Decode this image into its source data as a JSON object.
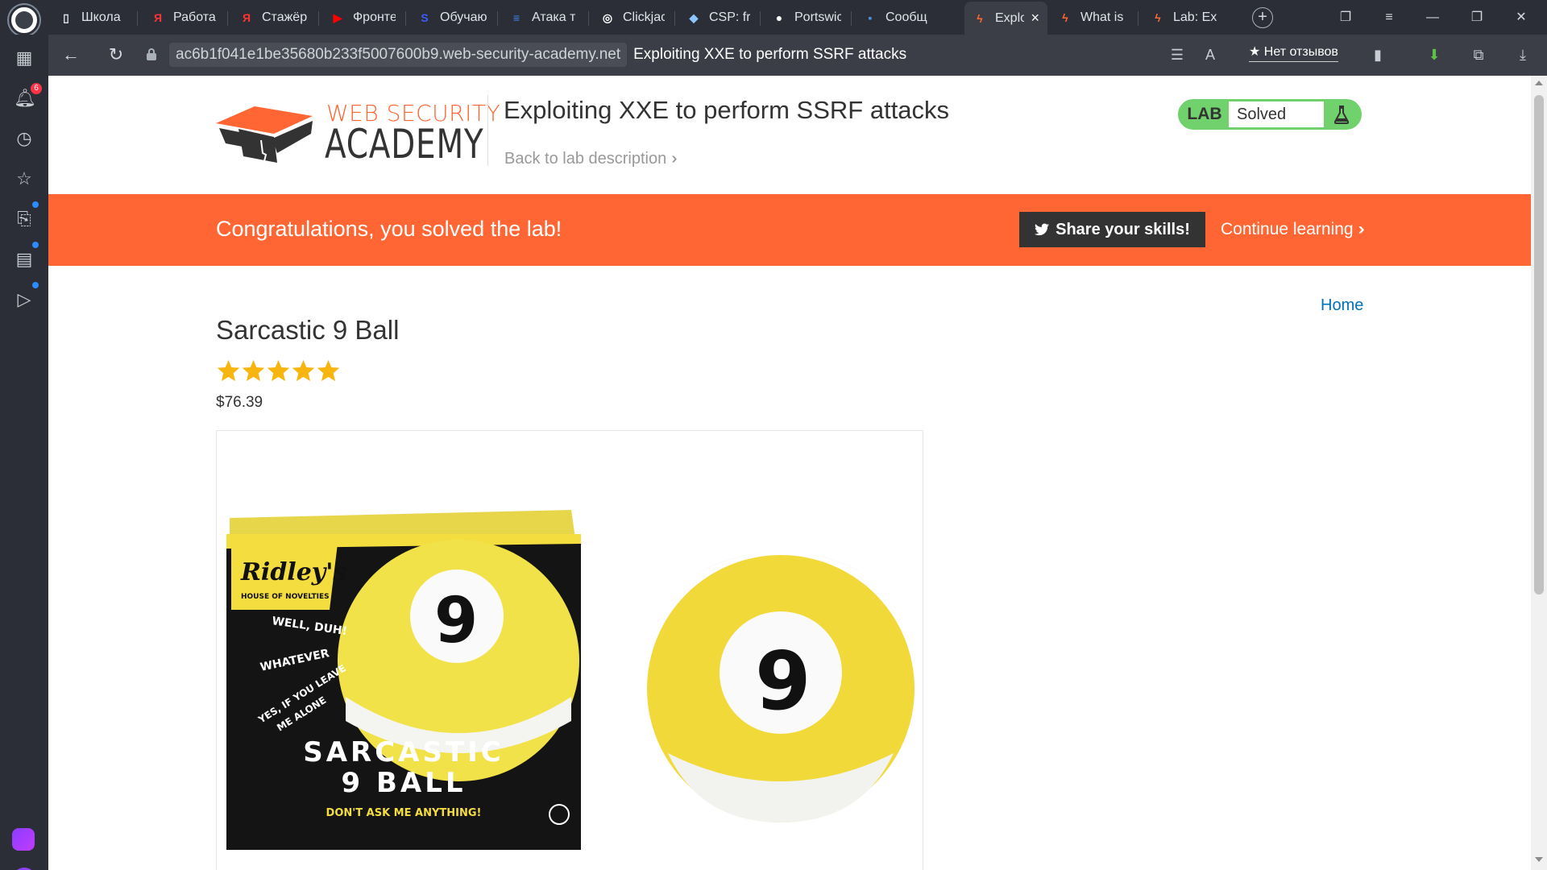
{
  "browser": {
    "tabs": [
      {
        "label": "Школа",
        "icon": "page-icon",
        "color": "#dfe3ea"
      },
      {
        "label": "Работа",
        "icon": "yandex-icon",
        "color": "#ff3333"
      },
      {
        "label": "Стажёр",
        "icon": "yandex-icon",
        "color": "#ff3333"
      },
      {
        "label": "Фронте",
        "icon": "youtube-icon",
        "color": "#ff0000"
      },
      {
        "label": "Обучаю",
        "icon": "s-icon",
        "color": "#3d5afe"
      },
      {
        "label": "Атака т",
        "icon": "docs-icon",
        "color": "#4285f4"
      },
      {
        "label": "Clickjac",
        "icon": "clickjack-icon",
        "color": "#ffffff"
      },
      {
        "label": "CSP: fra",
        "icon": "mdn-icon",
        "color": "#8ec5ff"
      },
      {
        "label": "Portswic",
        "icon": "github-icon",
        "color": "#ffffff"
      },
      {
        "label": "Сообщ",
        "icon": "chat-icon",
        "color": "#4a90e2"
      },
      {
        "label": "Explo",
        "icon": "portswigger-icon",
        "color": "#ff6633"
      },
      {
        "label": "What is",
        "icon": "portswigger-icon",
        "color": "#ff6633"
      },
      {
        "label": "Lab: Exp",
        "icon": "portswigger-icon",
        "color": "#ff6633"
      }
    ],
    "url": "ac6b1f041e1be35680b233f5007600b9.web-security-academy.net",
    "page_title": "Exploiting XXE to perform SSRF attacks",
    "reviews_label": "★ Нет отзывов",
    "notification_count": "6"
  },
  "header": {
    "logo_top": "WEB SECURITY",
    "logo_main": "ACADEMY",
    "lab_title": "Exploiting XXE to perform SSRF attacks",
    "back_link": "Back to lab description",
    "lab_badge": "LAB",
    "lab_state": "Solved"
  },
  "banner": {
    "message": "Congratulations, you solved the lab!",
    "share_label": "Share your skills!",
    "continue_label": "Continue learning"
  },
  "product": {
    "home_link": "Home",
    "title": "Sarcastic 9 Ball",
    "rating": 5,
    "price": "$76.39",
    "image_text": {
      "brand": "Ridley's",
      "brand_sub": "HOUSE OF NOVELTIES",
      "phrases": [
        "WELL, DUH!",
        "WHATEVER",
        "YES, IF YOU LEAVE",
        "ME ALONE"
      ],
      "name_line1": "SARCASTIC",
      "name_line2": "9 BALL",
      "tagline": "DON'T ASK ME ANYTHING!",
      "ball_number": "9"
    }
  },
  "colors": {
    "accent": "#ff6633",
    "solved_green": "#70d16d",
    "link_blue": "#0071bc",
    "star_gold": "#f9b50f"
  }
}
